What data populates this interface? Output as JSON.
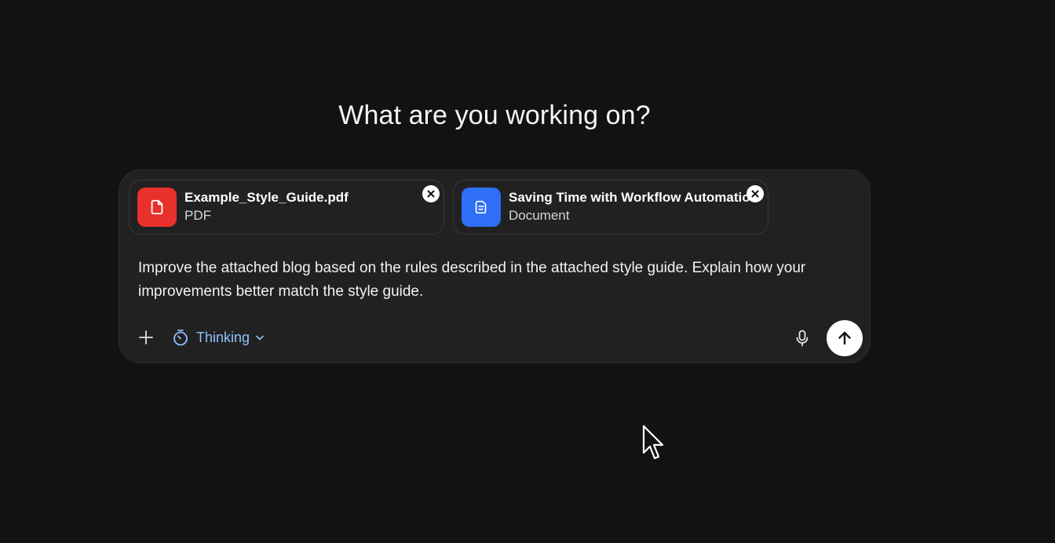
{
  "heading": "What are you working on?",
  "attachments": [
    {
      "name": "Example_Style_Guide.pdf",
      "type": "PDF",
      "icon": "pdf-file-icon",
      "color": "#e8302c"
    },
    {
      "name": "Saving Time with Workflow Automation",
      "type": "Document",
      "icon": "document-icon",
      "color": "#2f6ff6"
    }
  ],
  "prompt": "Improve the attached blog based on the rules described in the attached style guide. Explain how your improvements better match the style guide.",
  "toolbar": {
    "add_icon": "plus-icon",
    "mode_label": "Thinking",
    "mode_icon": "timer-icon",
    "mic_icon": "microphone-icon",
    "send_icon": "arrow-up-icon"
  },
  "colors": {
    "background": "#121212",
    "composer": "#212121",
    "accent": "#8fc1ff"
  }
}
